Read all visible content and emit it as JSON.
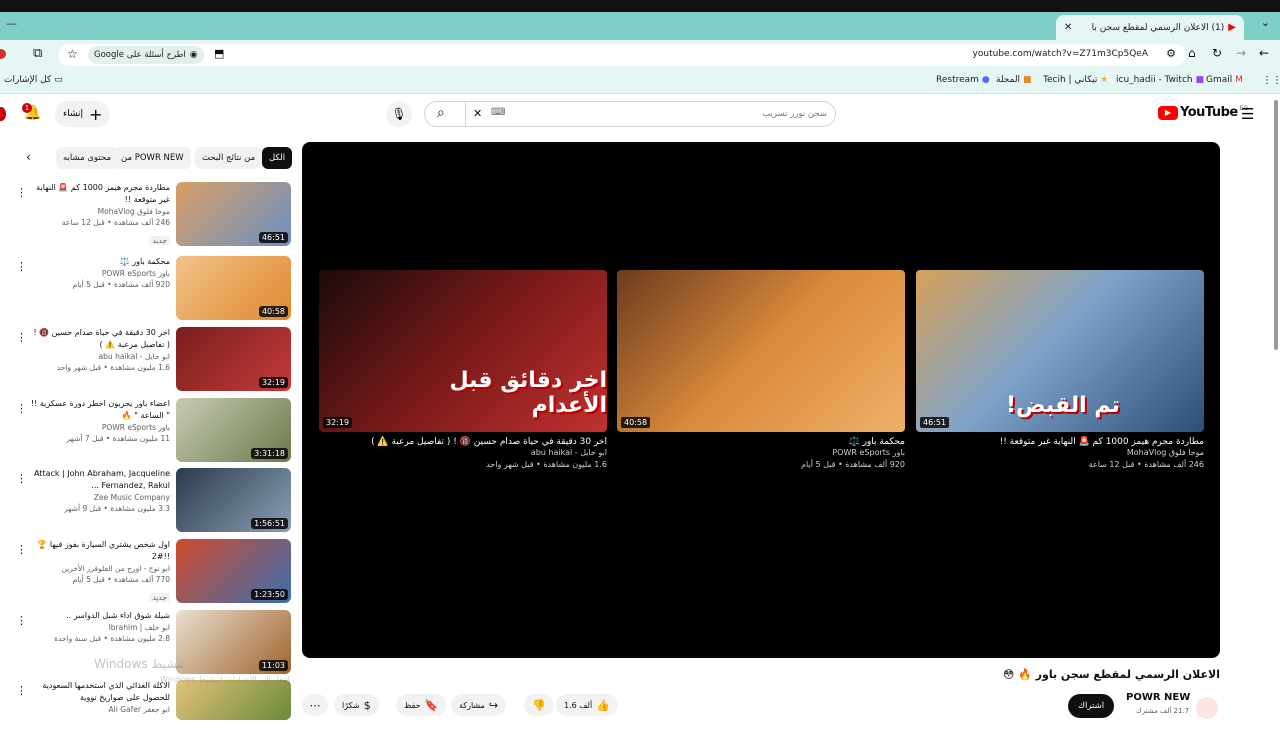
{
  "browser": {
    "tab_title": "(1) الاعلان الرسمي لمقطع سجن با",
    "url": "youtube.com/watch?v=Z71m3Cp5QeA",
    "lens_label": "Google اطرح أسئلة على",
    "bookmarks": {
      "gmail": "Gmail",
      "twitch": "icu_hadii - Twitch",
      "tecih": "Tecih | تيكاني",
      "magazine": "المجلة",
      "restream": "Restream",
      "all": "كل الإشارات"
    }
  },
  "youtube": {
    "logo": "YouTube",
    "logo_region": "EG",
    "search_placeholder": "سجن نورر تسريب",
    "create_label": "إنشاء",
    "notification_count": "1"
  },
  "chips": {
    "all": "الكل",
    "from_search": "من نتائج البحث",
    "from_channel": "من POWR NEW",
    "similar": "محتوى مشابه"
  },
  "sidebar_videos": [
    {
      "title": "مطاردة مجرم هيمز 1000 كم 🚨 النهاية غير متوقعة !!",
      "channel": "موحا فلوق MohaVlog",
      "meta": "246 ألف مشاهدة • قبل 12 ساعة",
      "badge": "جديد",
      "duration": "46:51"
    },
    {
      "title": "محكمة باور ⚖️",
      "channel": "باور POWR eSports",
      "meta": "920 ألف مشاهدة • قبل 5 أيام",
      "badge": "",
      "duration": "40:58"
    },
    {
      "title": "اخر 30 دقيقة في حياة صدام حسين 🔞 ! ( تفاصيل مرعبة ⚠️ )",
      "channel": "ابو حايل - abu haikal",
      "meta": "1.6 مليون مشاهدة • قبل شهر واحد",
      "badge": "",
      "duration": "32:19"
    },
    {
      "title": "اعضاء باور يجربون اخطر دورة عسكرية !! \" الساعة \" 🔥",
      "channel": "باور POWR eSports",
      "meta": "11 مليون مشاهدة • قبل 7 أشهر",
      "badge": "",
      "duration": "3:31:18"
    },
    {
      "title": "Attack | John Abraham, Jacqueline Fernandez, Rakul ...",
      "channel": "Zee Music Company",
      "meta": "3.3 مليون مشاهدة • قبل 9 أشهر",
      "badge": "",
      "duration": "1:56:51"
    },
    {
      "title": "اول شخص يشتري السيارة بفوز فيها 🏆 !!#2",
      "channel": "ابو نوح - اورج من الفلوقرز الأخرين",
      "meta": "770 ألف مشاهدة • قبل 5 أيام",
      "badge": "جديد",
      "duration": "1:23:50"
    },
    {
      "title": "شيلة شوق اداء شبل الدواسر ..",
      "channel": "ابو خلف | Ibrahim",
      "meta": "2.8 مليون مشاهدة • قبل سنة واحدة",
      "badge": "",
      "duration": "11:03"
    },
    {
      "title": "الاكلة الغذائي الذي استخدمها السعودية للحصول على صواريخ نووية",
      "channel": "ابو جعفر Ali Gafer",
      "meta": "",
      "badge": "",
      "duration": ""
    }
  ],
  "end_cards": [
    {
      "title": "مطاردة مجرم هيمز 1000 كم 🚨 النهاية غير متوقعة !!",
      "channel": "موحا فلوق MohaVlog",
      "meta": "246 ألف مشاهدة • قبل 12 ساعة",
      "duration": "46:51",
      "thumb_text": "تم القبض!"
    },
    {
      "title": "محكمة باور ⚖️",
      "channel": "باور POWR eSports",
      "meta": "920 ألف مشاهدة • قبل 5 أيام",
      "duration": "40:58",
      "thumb_text": ""
    },
    {
      "title": "اخر 30 دقيقة في حياة صدام حسين 🔞 ! ( تفاصيل مرعبة ⚠️ )",
      "channel": "ابو حايل - abu haikal",
      "meta": "1.6 مليون مشاهدة • قبل شهر واحد",
      "duration": "32:19",
      "thumb_text": "اخر دقائق قبل الأعدام"
    }
  ],
  "video": {
    "title": "الاعلان الرسمي لمقطع سجن باور 🔥 😳",
    "channel": "POWR NEW",
    "subs": "21.7 ألف مشترك",
    "subscribe": "اشتراك",
    "likes": "1.6 ألف",
    "share": "مشاركة",
    "save": "حفظ",
    "thanks": "شكرًا"
  },
  "watermark": {
    "line1": "تنشيط Windows",
    "line2": "انتقل إلى الإعدادات لتنشيط Windows."
  },
  "colors": {
    "tabstrip": "#7ecfc6",
    "youtube_red": "#ff0000",
    "accent": "#0f0f0f"
  }
}
